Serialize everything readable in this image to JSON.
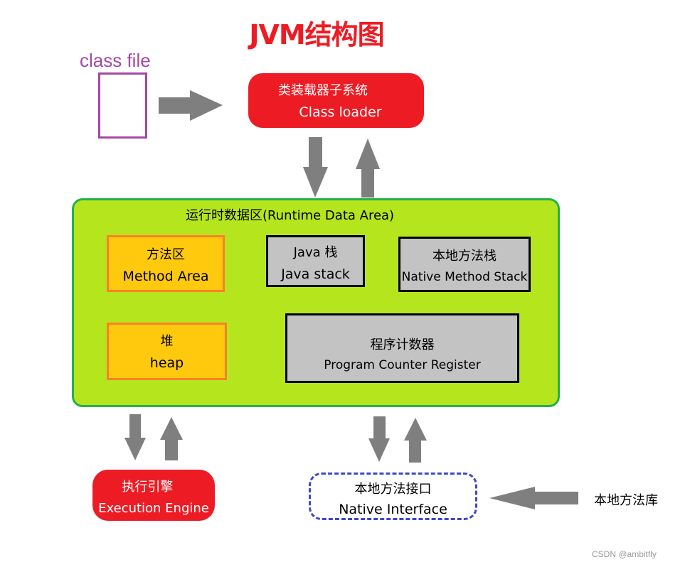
{
  "title": "JVM结构图",
  "class_file": {
    "label": "class file"
  },
  "class_loader": {
    "zh": "类装载器子系统",
    "en": "Class loader"
  },
  "runtime_data_area": {
    "label": "运行时数据区(Runtime Data Area)",
    "method_area": {
      "zh": "方法区",
      "en": "Method Area"
    },
    "java_stack": {
      "zh": "Java 栈",
      "en": "Java stack"
    },
    "native_method_stack": {
      "zh": "本地方法栈",
      "en": "Native Method Stack"
    },
    "heap": {
      "zh": "堆",
      "en": "heap"
    },
    "program_counter": {
      "zh": "程序计数器",
      "en": "Program Counter Register"
    }
  },
  "execution_engine": {
    "zh": "执行引擎",
    "en": "Execution Engine"
  },
  "native_interface": {
    "zh": "本地方法接口",
    "en": "Native Interface"
  },
  "native_library": {
    "label": "本地方法库"
  },
  "watermark": "CSDN @ambitfly",
  "colors": {
    "title": "#ed1c24",
    "red_box": "#ed1c24",
    "class_file": "#a349a4",
    "runtime_fill": "#b5e61d",
    "runtime_border": "#22b14c",
    "orange_fill": "#ffc90e",
    "orange_border": "#ff7f27",
    "gray_fill": "#c3c3c3",
    "arrow": "#7f7f7f",
    "dashed_border": "#3f48cc"
  },
  "arrows": [
    {
      "name": "arrow-classfile-to-loader",
      "direction": "right"
    },
    {
      "name": "arrow-loader-to-runtime",
      "direction": "down"
    },
    {
      "name": "arrow-runtime-to-loader",
      "direction": "up"
    },
    {
      "name": "arrow-runtime-to-engine",
      "direction": "down"
    },
    {
      "name": "arrow-engine-to-runtime",
      "direction": "up"
    },
    {
      "name": "arrow-runtime-to-native-interface",
      "direction": "down"
    },
    {
      "name": "arrow-native-interface-to-runtime",
      "direction": "up"
    },
    {
      "name": "arrow-library-to-native-interface",
      "direction": "left"
    }
  ]
}
